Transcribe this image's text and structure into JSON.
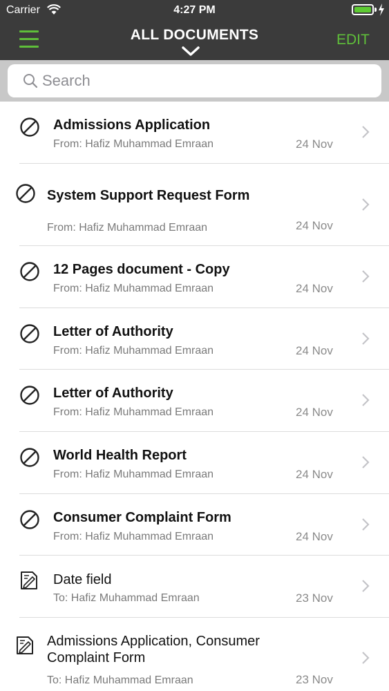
{
  "status_bar": {
    "carrier": "Carrier",
    "time": "4:27 PM"
  },
  "nav": {
    "title": "ALL DOCUMENTS",
    "edit_label": "EDIT",
    "accent_color": "#5fbf3a",
    "bar_color": "#3b3b3b"
  },
  "search": {
    "placeholder": "Search",
    "value": ""
  },
  "documents": [
    {
      "icon": "no-entry-icon",
      "title": "Admissions Application",
      "subtitle": "From: Hafiz Muhammad Emraan",
      "date": "24 Nov"
    },
    {
      "icon": "no-entry-icon",
      "title": "System Support Request Form",
      "subtitle": "From: Hafiz Muhammad Emraan",
      "date": "24 Nov"
    },
    {
      "icon": "no-entry-icon",
      "title": "12 Pages document - Copy",
      "subtitle": "From: Hafiz Muhammad Emraan",
      "date": "24 Nov"
    },
    {
      "icon": "no-entry-icon",
      "title": "Letter of Authority",
      "subtitle": "From: Hafiz Muhammad Emraan",
      "date": "24 Nov"
    },
    {
      "icon": "no-entry-icon",
      "title": "Letter of Authority",
      "subtitle": "From: Hafiz Muhammad Emraan",
      "date": "24 Nov"
    },
    {
      "icon": "no-entry-icon",
      "title": "World Health Report",
      "subtitle": "From: Hafiz Muhammad Emraan",
      "date": "24 Nov"
    },
    {
      "icon": "no-entry-icon",
      "title": "Consumer Complaint Form",
      "subtitle": "From: Hafiz Muhammad Emraan",
      "date": "24 Nov"
    },
    {
      "icon": "sign-document-icon",
      "title": "Date field",
      "subtitle": "To: Hafiz Muhammad Emraan",
      "date": "23 Nov"
    },
    {
      "icon": "sign-document-icon",
      "title": "Admissions Application, Consumer Complaint Form",
      "subtitle": "To: Hafiz Muhammad Emraan",
      "date": "23 Nov"
    }
  ]
}
